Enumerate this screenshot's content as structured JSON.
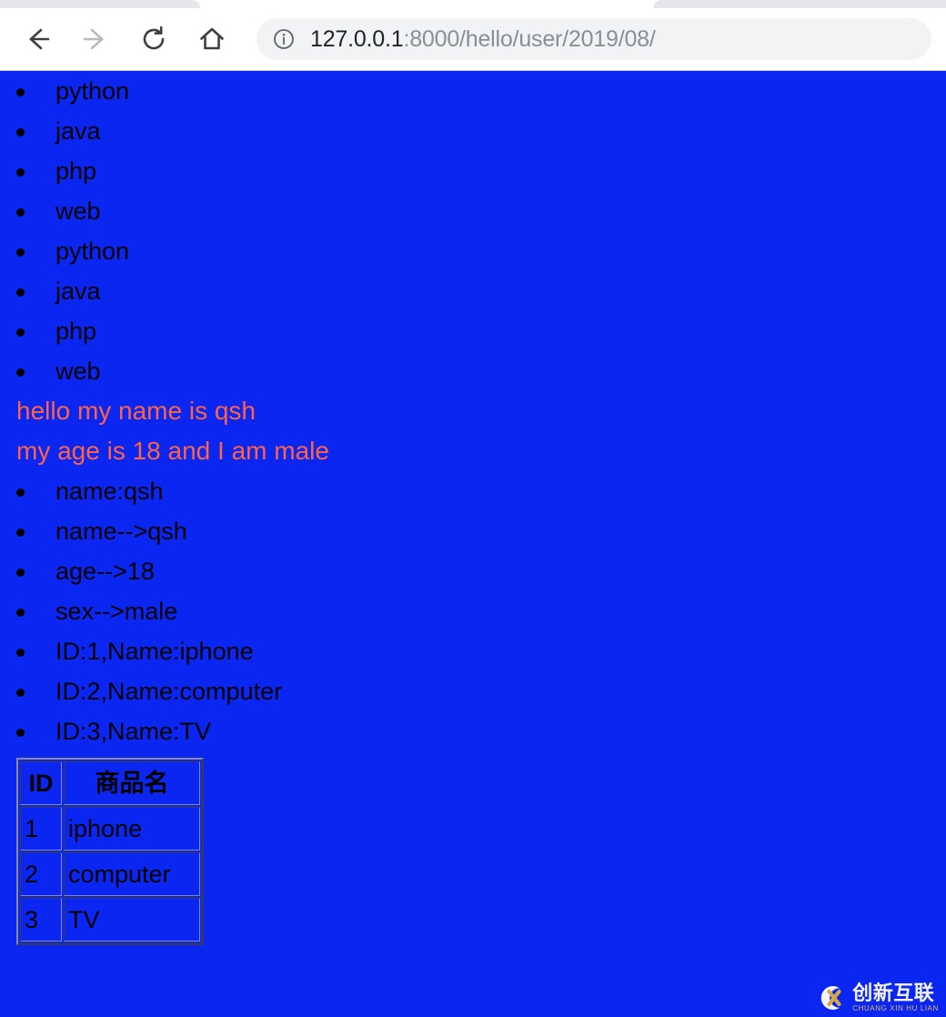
{
  "browser": {
    "nav": {
      "back_label": "Back",
      "forward_label": "Forward",
      "reload_label": "Reload",
      "home_label": "Home"
    },
    "omnibox": {
      "security_icon": "info-circle-icon",
      "url_host": "127.0.0.1",
      "url_rest": ":8000/hello/user/2019/08/",
      "url_full": "127.0.0.1:8000/hello/user/2019/08/"
    }
  },
  "page": {
    "background_color": "#0A26F0",
    "list_one": [
      "python",
      "java",
      "php",
      "web",
      "python",
      "java",
      "php",
      "web"
    ],
    "highlight_lines": [
      "hello my name is qsh",
      "my age is 18 and I am male"
    ],
    "highlight_color": "#FF6347",
    "list_two": [
      "name:qsh",
      "name-->qsh",
      "age-->18",
      "sex-->male",
      "ID:1,Name:iphone",
      "ID:2,Name:computer",
      "ID:3,Name:TV"
    ],
    "table": {
      "headers": [
        "ID",
        "商品名"
      ],
      "rows": [
        [
          "1",
          "iphone"
        ],
        [
          "2",
          "computer"
        ],
        [
          "3",
          "TV"
        ]
      ]
    },
    "watermark": {
      "cn": "创新互联",
      "en": "CHUANG XIN HU LIAN"
    }
  }
}
